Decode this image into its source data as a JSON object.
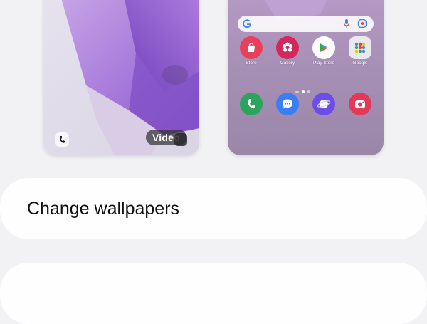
{
  "lock_preview": {
    "video_chip": "Video"
  },
  "home_preview": {
    "apps_row1": [
      {
        "label": "Store",
        "color": "#e8405a",
        "icon": "bag-icon"
      },
      {
        "label": "Gallery",
        "color": "#d4275a",
        "icon": "flower-icon"
      },
      {
        "label": "Play Store",
        "color": "#ffffff",
        "icon": "play-icon"
      },
      {
        "label": "Google",
        "color": "#e9e9ec",
        "icon": "folder-icon"
      }
    ],
    "apps_row2": [
      {
        "label": "",
        "color": "#2aa55b",
        "icon": "phone-icon"
      },
      {
        "label": "",
        "color": "#3b7df3",
        "icon": "messages-icon"
      },
      {
        "label": "",
        "color": "#6b4ee8",
        "icon": "internet-icon"
      },
      {
        "label": "",
        "color": "#e33a58",
        "icon": "camera-icon"
      }
    ]
  },
  "menu": {
    "change_wallpapers": "Change wallpapers"
  }
}
